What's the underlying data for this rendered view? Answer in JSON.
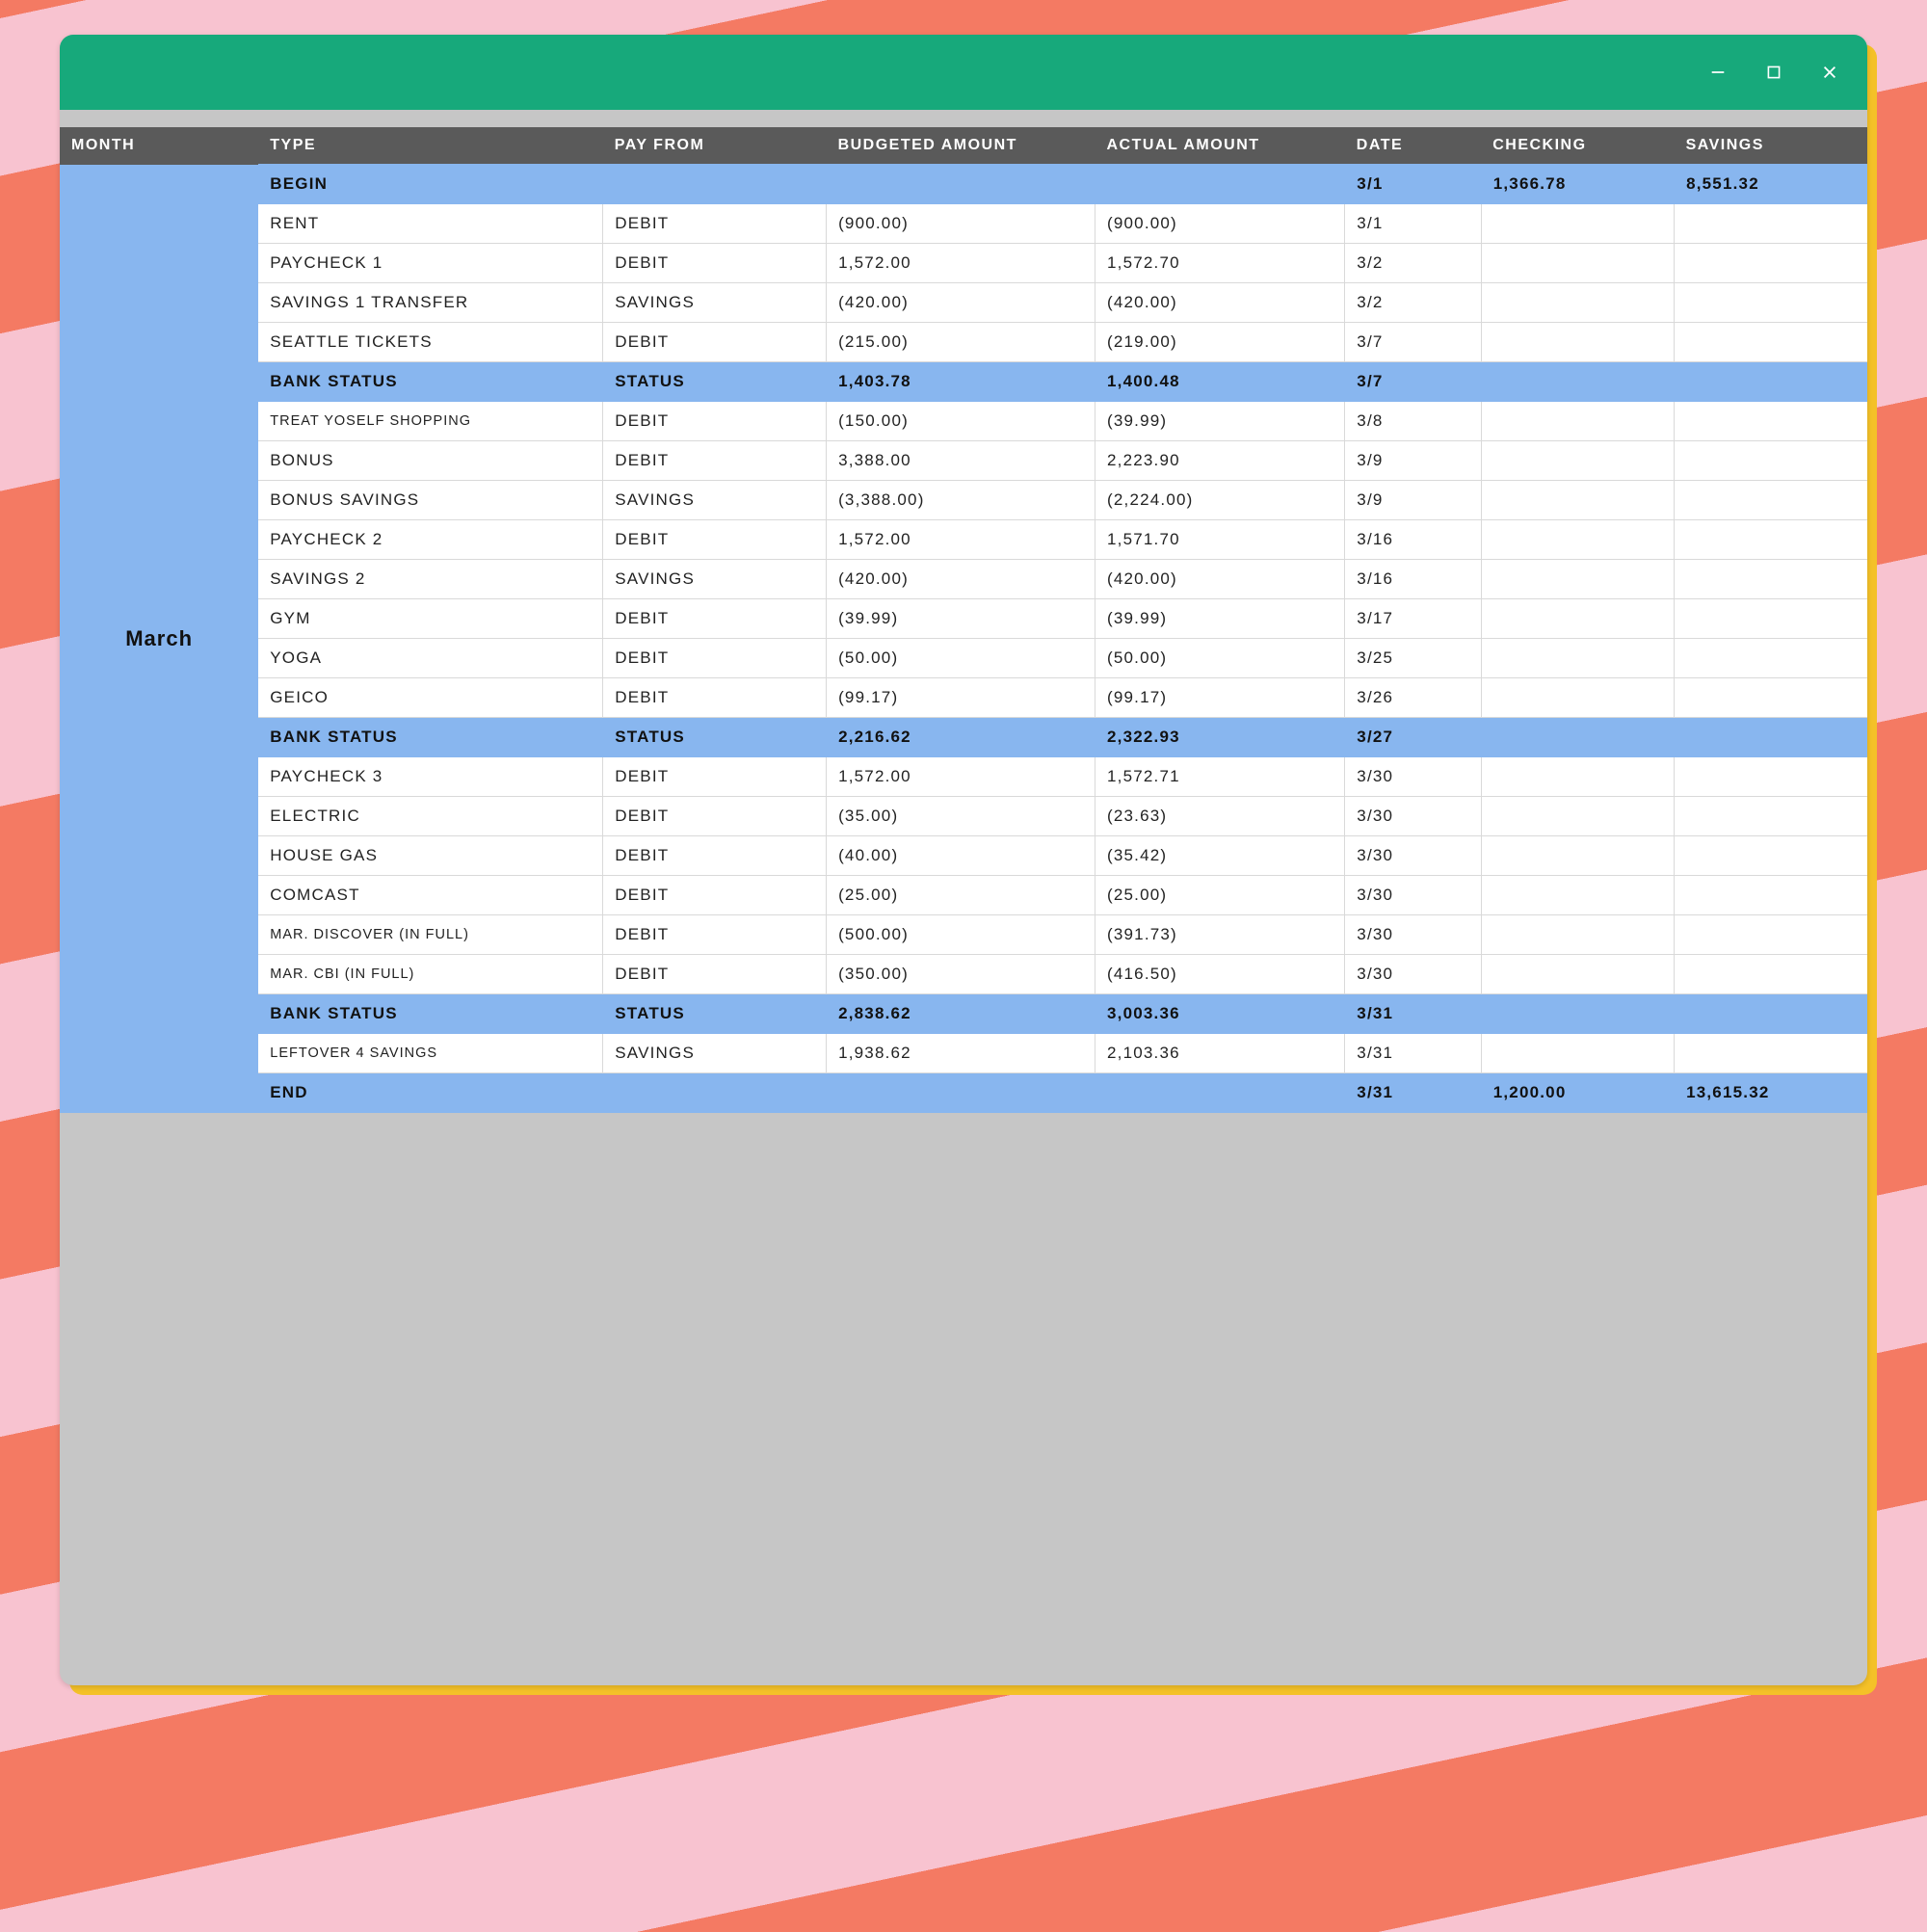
{
  "columns": {
    "month": "MONTH",
    "type": "TYPE",
    "pay_from": "PAY FROM",
    "budgeted": "BUDGETED AMOUNT",
    "actual": "ACTUAL AMOUNT",
    "date": "DATE",
    "checking": "CHECKING",
    "savings": "SAVINGS"
  },
  "month_label": "March",
  "rows": [
    {
      "highlight": true,
      "type": "BEGIN",
      "pay_from": "",
      "budgeted": "",
      "actual": "",
      "date": "3/1",
      "checking": "1,366.78",
      "savings": "8,551.32"
    },
    {
      "highlight": false,
      "type": "RENT",
      "pay_from": "DEBIT",
      "budgeted": "(900.00)",
      "actual": "(900.00)",
      "date": "3/1",
      "checking": "",
      "savings": ""
    },
    {
      "highlight": false,
      "type": "PAYCHECK 1",
      "pay_from": "DEBIT",
      "budgeted": "1,572.00",
      "actual": "1,572.70",
      "date": "3/2",
      "checking": "",
      "savings": ""
    },
    {
      "highlight": false,
      "type": "SAVINGS 1 TRANSFER",
      "pay_from": "SAVINGS",
      "budgeted": "(420.00)",
      "actual": "(420.00)",
      "date": "3/2",
      "checking": "",
      "savings": ""
    },
    {
      "highlight": false,
      "type": "SEATTLE TICKETS",
      "pay_from": "DEBIT",
      "budgeted": "(215.00)",
      "actual": "(219.00)",
      "date": "3/7",
      "checking": "",
      "savings": ""
    },
    {
      "highlight": true,
      "type": "BANK STATUS",
      "pay_from": "STATUS",
      "budgeted": "1,403.78",
      "actual": "1,400.48",
      "date": "3/7",
      "checking": "",
      "savings": ""
    },
    {
      "highlight": false,
      "small": true,
      "type": "TREAT YOSELF SHOPPING",
      "pay_from": "DEBIT",
      "budgeted": "(150.00)",
      "actual": "(39.99)",
      "date": "3/8",
      "checking": "",
      "savings": ""
    },
    {
      "highlight": false,
      "type": "BONUS",
      "pay_from": "DEBIT",
      "budgeted": "3,388.00",
      "actual": "2,223.90",
      "date": "3/9",
      "checking": "",
      "savings": ""
    },
    {
      "highlight": false,
      "type": "BONUS SAVINGS",
      "pay_from": "SAVINGS",
      "budgeted": "(3,388.00)",
      "actual": "(2,224.00)",
      "date": "3/9",
      "checking": "",
      "savings": ""
    },
    {
      "highlight": false,
      "type": "PAYCHECK 2",
      "pay_from": "DEBIT",
      "budgeted": "1,572.00",
      "actual": "1,571.70",
      "date": "3/16",
      "checking": "",
      "savings": ""
    },
    {
      "highlight": false,
      "type": "SAVINGS 2",
      "pay_from": "SAVINGS",
      "budgeted": "(420.00)",
      "actual": "(420.00)",
      "date": "3/16",
      "checking": "",
      "savings": ""
    },
    {
      "highlight": false,
      "type": "GYM",
      "pay_from": "DEBIT",
      "budgeted": "(39.99)",
      "actual": "(39.99)",
      "date": "3/17",
      "checking": "",
      "savings": ""
    },
    {
      "highlight": false,
      "type": "YOGA",
      "pay_from": "DEBIT",
      "budgeted": "(50.00)",
      "actual": "(50.00)",
      "date": "3/25",
      "checking": "",
      "savings": ""
    },
    {
      "highlight": false,
      "type": "GEICO",
      "pay_from": "DEBIT",
      "budgeted": "(99.17)",
      "actual": "(99.17)",
      "date": "3/26",
      "checking": "",
      "savings": ""
    },
    {
      "highlight": true,
      "type": "BANK STATUS",
      "pay_from": "STATUS",
      "budgeted": "2,216.62",
      "actual": "2,322.93",
      "date": "3/27",
      "checking": "",
      "savings": ""
    },
    {
      "highlight": false,
      "type": "PAYCHECK 3",
      "pay_from": "DEBIT",
      "budgeted": "1,572.00",
      "actual": "1,572.71",
      "date": "3/30",
      "checking": "",
      "savings": ""
    },
    {
      "highlight": false,
      "type": "ELECTRIC",
      "pay_from": "DEBIT",
      "budgeted": "(35.00)",
      "actual": "(23.63)",
      "date": "3/30",
      "checking": "",
      "savings": ""
    },
    {
      "highlight": false,
      "type": "HOUSE GAS",
      "pay_from": "DEBIT",
      "budgeted": "(40.00)",
      "actual": "(35.42)",
      "date": "3/30",
      "checking": "",
      "savings": ""
    },
    {
      "highlight": false,
      "type": "COMCAST",
      "pay_from": "DEBIT",
      "budgeted": "(25.00)",
      "actual": "(25.00)",
      "date": "3/30",
      "checking": "",
      "savings": ""
    },
    {
      "highlight": false,
      "small": true,
      "type": "MAR. DISCOVER (IN FULL)",
      "pay_from": "DEBIT",
      "budgeted": "(500.00)",
      "actual": "(391.73)",
      "date": "3/30",
      "checking": "",
      "savings": ""
    },
    {
      "highlight": false,
      "small": true,
      "type": "MAR. CBI (IN FULL)",
      "pay_from": "DEBIT",
      "budgeted": "(350.00)",
      "actual": "(416.50)",
      "date": "3/30",
      "checking": "",
      "savings": ""
    },
    {
      "highlight": true,
      "type": "BANK STATUS",
      "pay_from": "STATUS",
      "budgeted": "2,838.62",
      "actual": "3,003.36",
      "date": "3/31",
      "checking": "",
      "savings": ""
    },
    {
      "highlight": false,
      "small": true,
      "type": "LEFTOVER 4 SAVINGS",
      "pay_from": "SAVINGS",
      "budgeted": "1,938.62",
      "actual": "2,103.36",
      "date": "3/31",
      "checking": "",
      "savings": ""
    },
    {
      "highlight": true,
      "type": "END",
      "pay_from": "",
      "budgeted": "",
      "actual": "",
      "date": "3/31",
      "checking": "1,200.00",
      "savings": "13,615.32"
    }
  ]
}
